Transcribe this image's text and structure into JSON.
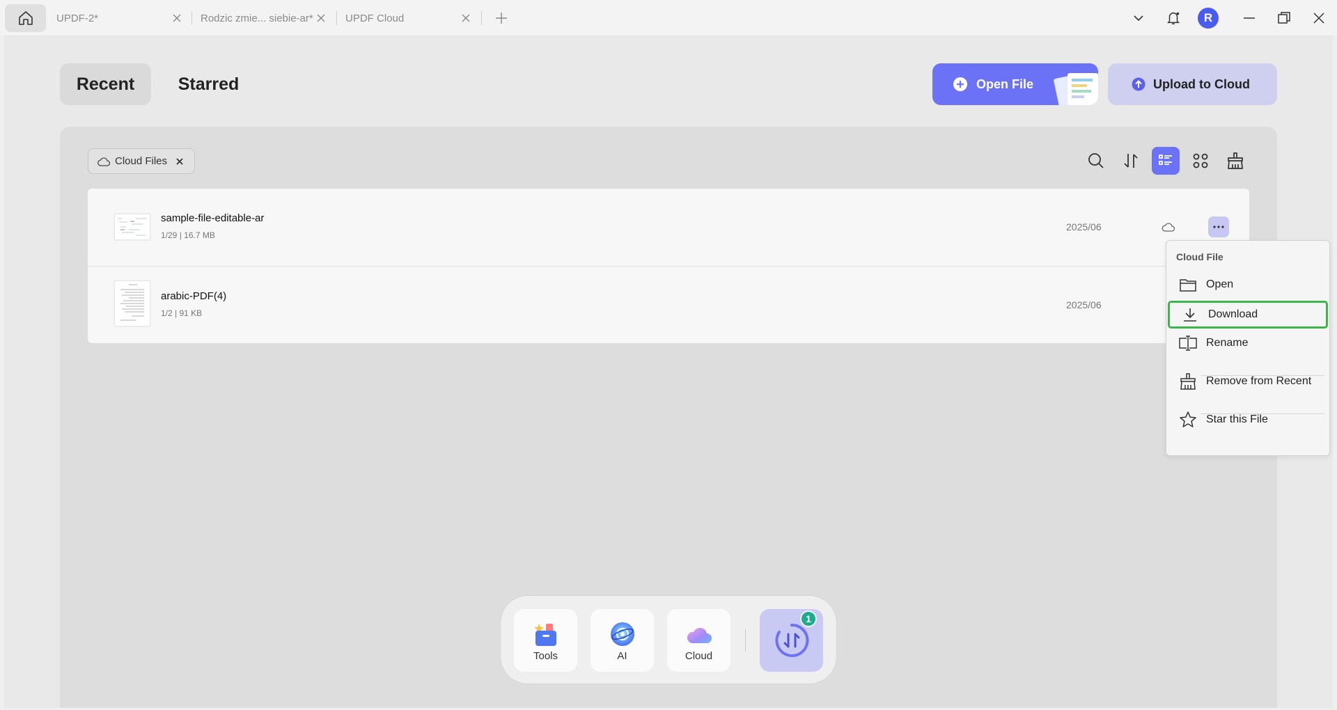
{
  "tabs": [
    {
      "label": "UPDF-2*"
    },
    {
      "label": "Rodzic zmie... siebie-ar*"
    },
    {
      "label": "UPDF Cloud"
    }
  ],
  "user": {
    "avatar_initial": "R",
    "avatar_color": "#4a5cf0"
  },
  "view_tabs": {
    "recent": "Recent",
    "starred": "Starred"
  },
  "actions": {
    "open_file": "Open File",
    "upload_to_cloud": "Upload to Cloud"
  },
  "filter": {
    "chip_label": "Cloud Files"
  },
  "toolbar_icons": [
    "search-icon",
    "sort-icon",
    "list-view-icon",
    "grid-view-icon",
    "clear-icon"
  ],
  "files": [
    {
      "name": "sample-file-editable-ar",
      "meta": "1/29 | 16.7 MB",
      "date": "2025/06"
    },
    {
      "name": "arabic-PDF(4)",
      "meta": "1/2 | 91 KB",
      "date": "2025/06"
    }
  ],
  "context_menu": {
    "title": "Cloud File",
    "items": [
      {
        "label": "Open",
        "icon": "folder-icon"
      },
      {
        "label": "Download",
        "icon": "download-icon"
      },
      {
        "label": "Rename",
        "icon": "rename-icon"
      },
      {
        "label": "Remove from Recent",
        "icon": "broom-icon"
      },
      {
        "label": "Star this File",
        "icon": "star-icon"
      }
    ]
  },
  "dock": {
    "tools": "Tools",
    "ai": "AI",
    "cloud": "Cloud",
    "sync_badge": "1"
  },
  "colors": {
    "accent": "#6b72f5",
    "accent_light": "#cfd0ef",
    "highlight_border": "#3cb54a",
    "badge": "#1faa8c"
  }
}
